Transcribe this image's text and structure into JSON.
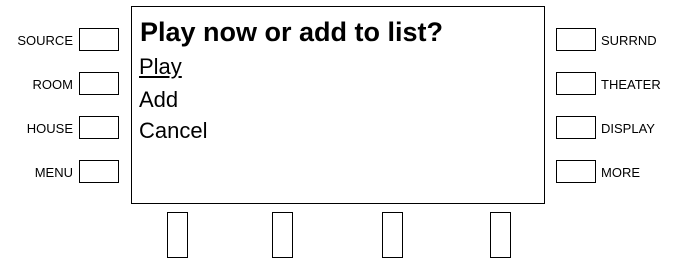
{
  "left_keys": [
    {
      "label": "SOURCE"
    },
    {
      "label": "ROOM"
    },
    {
      "label": "HOUSE"
    },
    {
      "label": "MENU"
    }
  ],
  "right_keys": [
    {
      "label": "SURRND"
    },
    {
      "label": "THEATER"
    },
    {
      "label": "DISPLAY"
    },
    {
      "label": "MORE"
    }
  ],
  "screen": {
    "prompt": "Play now or add to list?",
    "options": [
      {
        "label": "Play",
        "selected": true
      },
      {
        "label": "Add",
        "selected": false
      },
      {
        "label": "Cancel",
        "selected": false
      }
    ]
  }
}
